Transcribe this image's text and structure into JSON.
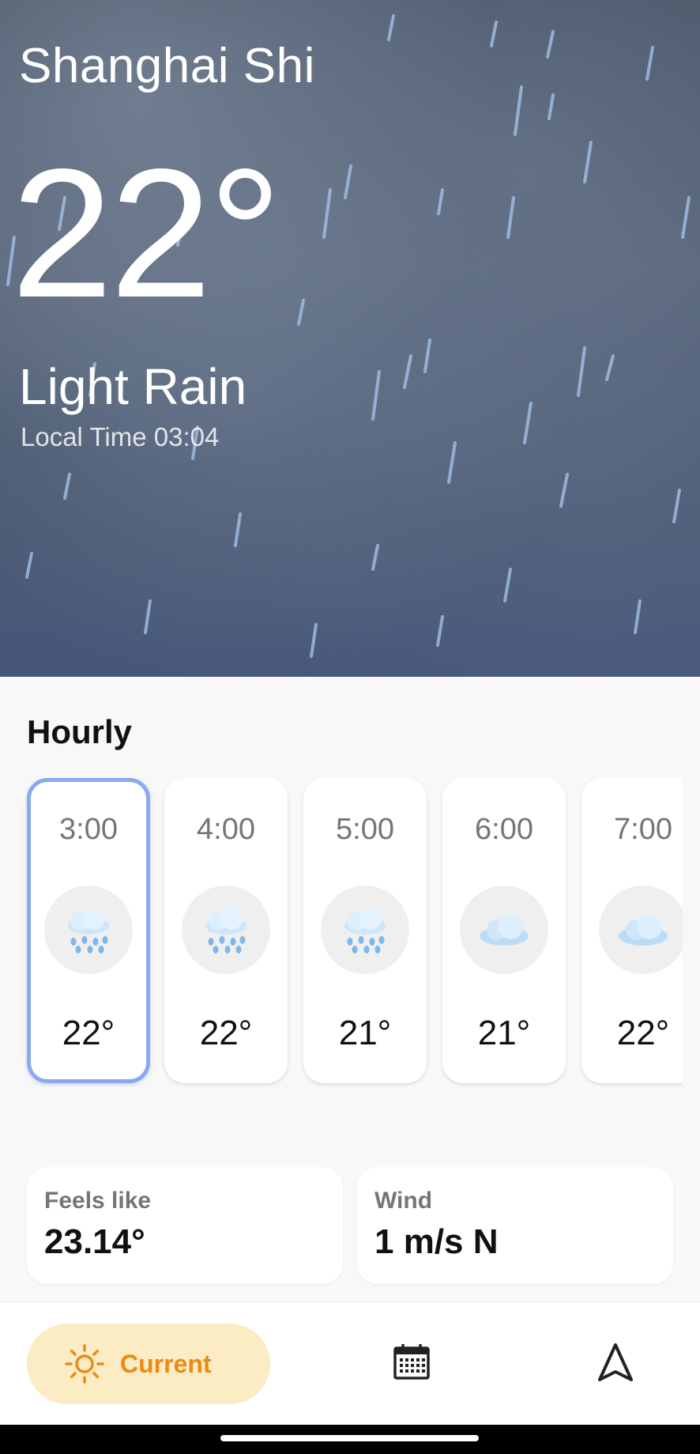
{
  "location": {
    "city": "Shanghai Shi"
  },
  "current": {
    "temperature": "22°",
    "condition": "Light Rain",
    "local_time": "Local Time 03:04"
  },
  "hourly": {
    "title": "Hourly",
    "items": [
      {
        "time": "3:00",
        "temp": "22°",
        "icon": "rain-cloud-icon",
        "selected": true
      },
      {
        "time": "4:00",
        "temp": "22°",
        "icon": "rain-cloud-icon",
        "selected": false
      },
      {
        "time": "5:00",
        "temp": "21°",
        "icon": "rain-cloud-icon",
        "selected": false
      },
      {
        "time": "6:00",
        "temp": "21°",
        "icon": "cloud-icon",
        "selected": false
      },
      {
        "time": "7:00",
        "temp": "22°",
        "icon": "cloud-icon",
        "selected": false
      }
    ]
  },
  "details": {
    "feels_like_label": "Feels like",
    "feels_like_value": "23.14°",
    "wind_label": "Wind",
    "wind_value": "1 m/s N"
  },
  "nav": {
    "current_label": "Current",
    "current_icon": "sun-icon",
    "calendar_icon": "calendar-icon",
    "location_icon": "navigation-arrow-icon"
  },
  "colors": {
    "accent": "#ea8a17",
    "accent_bg": "#fcecc4",
    "selected_border": "#8aaaf0",
    "rain_drop": "#8cc3ec"
  }
}
